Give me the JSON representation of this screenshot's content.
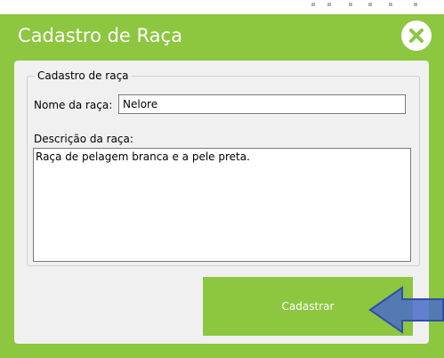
{
  "dialog": {
    "title": "Cadastro de Raça",
    "close_icon": "close-icon"
  },
  "form": {
    "group_title": "Cadastro de raça",
    "name_label": "Nome da raça:",
    "name_value": "Nelore",
    "description_label": "Descrição da raça:",
    "description_value": "Raça de pelagem branca e a pele preta.",
    "submit_label": "Cadastrar"
  },
  "annotation": {
    "icon": "arrow-left-icon",
    "color": "#4a6cc8"
  },
  "colors": {
    "accent": "#8dc63f",
    "panel": "#f0f0f0"
  }
}
